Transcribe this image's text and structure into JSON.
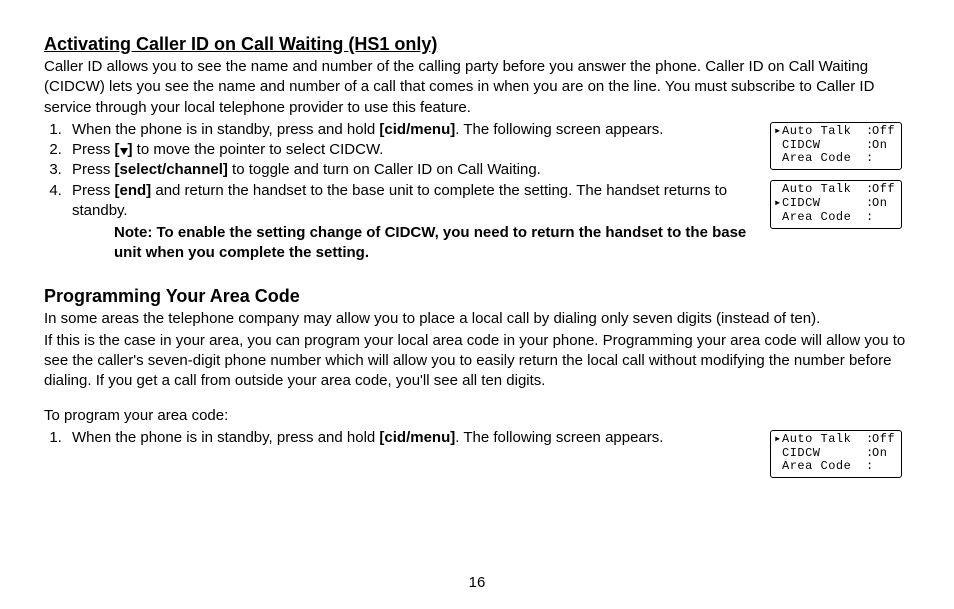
{
  "section1": {
    "heading": "Activating Caller ID on Call Waiting (HS1 only)",
    "intro": "Caller ID allows you to see the name and number of the calling party before you answer the phone. Caller ID on Call Waiting (CIDCW) lets you see the name and number of a call that comes in when you are on the line. You must subscribe to Caller ID service through your local telephone provider to use this feature.",
    "step1_a": "When the phone is in standby, press and hold ",
    "step1_key": "[cid/menu]",
    "step1_b": ". The following screen appears.",
    "step2_a": "Press ",
    "step2_key_open": "[",
    "step2_key_close": "]",
    "step2_b": " to move the pointer to select CIDCW.",
    "step3_a": "Press ",
    "step3_key": "[select/channel]",
    "step3_b": " to toggle and turn on Caller ID on Call Waiting.",
    "step4_a": "Press ",
    "step4_key": "[end]",
    "step4_b": " and return the handset to the base unit to complete the setting. The handset returns to standby.",
    "note": "Note: To enable the setting change of CIDCW, you need to return the handset to the base unit when you complete the setting."
  },
  "screens": {
    "row1": {
      "label": "Auto Talk",
      "value": "Off"
    },
    "row2": {
      "label": "CIDCW",
      "value": "On"
    },
    "row3": {
      "label": "Area Code",
      "value": ""
    }
  },
  "section2": {
    "heading": "Programming Your Area Code",
    "p1": "In some areas the telephone company may allow you to place a local call by dialing only seven digits (instead of ten).",
    "p2": "If this is the case in your area, you can program your local area code in your phone. Programming your area code will allow you to see the caller's seven-digit phone number which will allow you to easily return the local call without modifying the number before dialing. If you get a call from outside your area code, you'll see all ten digits.",
    "lead": "To program your area code:",
    "step1_a": "When the phone is in standby, press and hold ",
    "step1_key": "[cid/menu]",
    "step1_b": ". The following screen appears."
  },
  "page_number": "16"
}
